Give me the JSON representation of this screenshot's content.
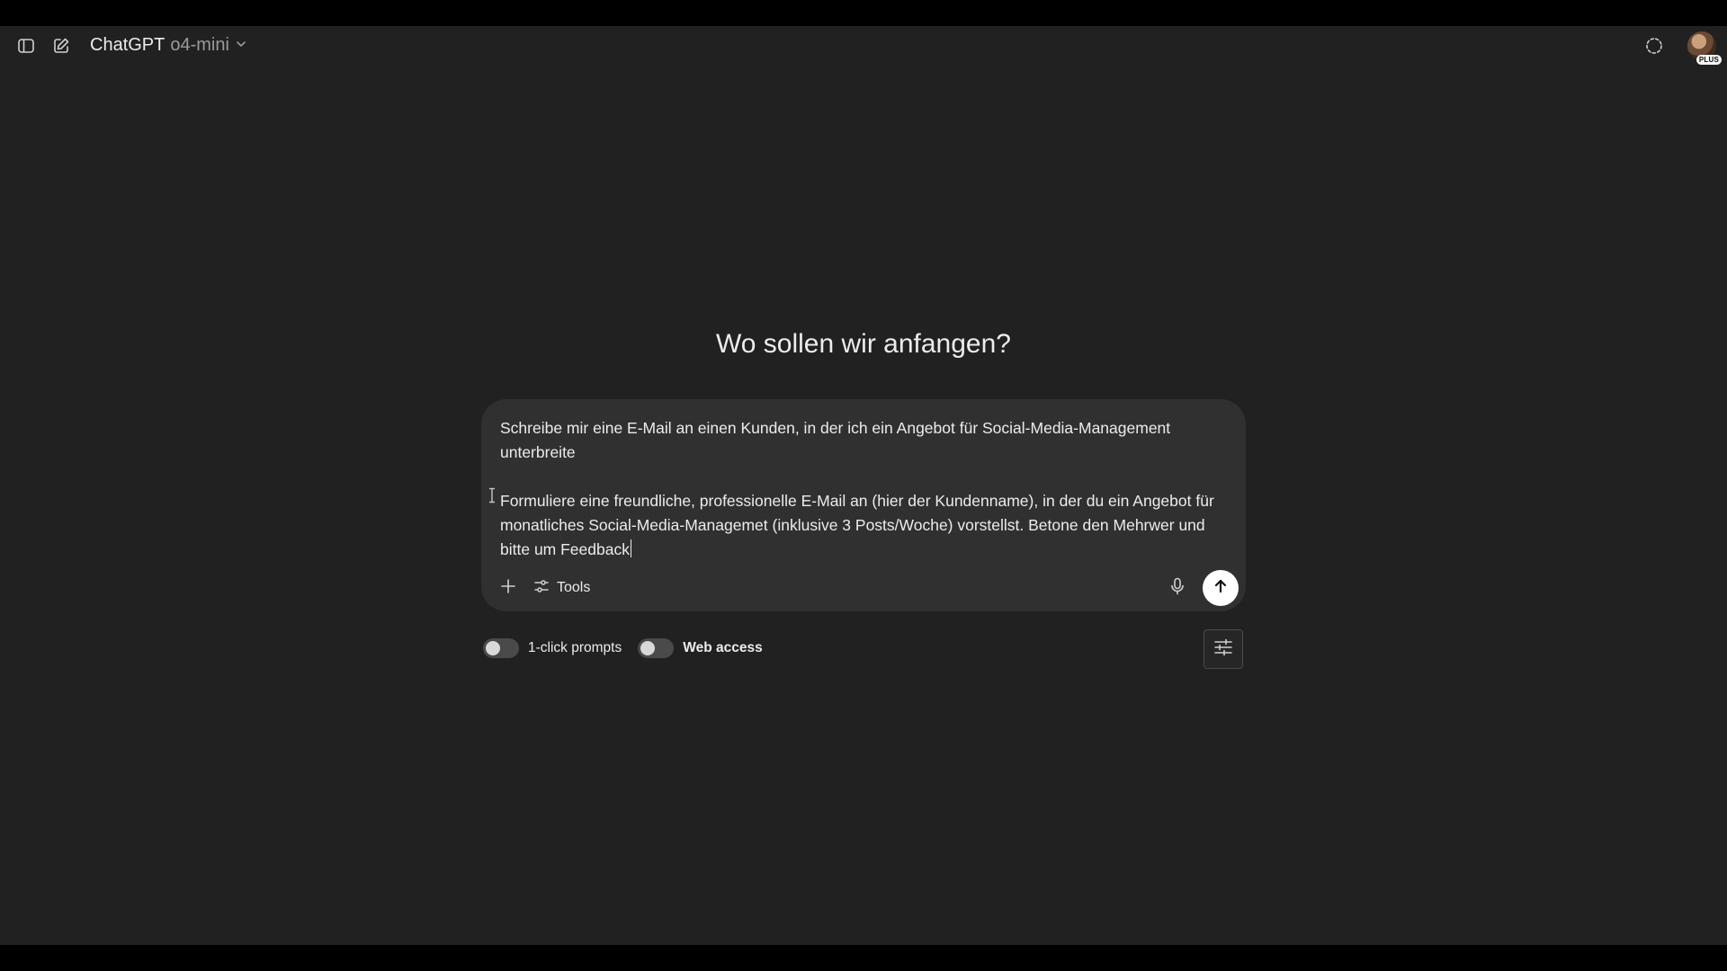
{
  "header": {
    "model_name": "ChatGPT",
    "model_variant": "o4-mini",
    "badge": "PLUS",
    "icons": [
      "sidebar-toggle-icon",
      "new-chat-icon",
      "chevron-down-icon",
      "temporary-chat-icon"
    ]
  },
  "main": {
    "headline": "Wo sollen wir anfangen?"
  },
  "composer": {
    "text": "Schreibe mir eine E-Mail an einen Kunden, in der ich ein Angebot für Social-Media-Management unterbreite\n\nFormuliere eine freundliche, professionelle E-Mail an (hier der Kundenname), in der du ein Angebot für monatliches Social-Media-Managemet (inklusive 3 Posts/Woche) vorstellst. Betone den Mehrwer und bitte um Feedback",
    "tools_label": "Tools",
    "icons": [
      "plus-icon",
      "tools-icon",
      "microphone-icon",
      "arrow-up-icon"
    ]
  },
  "toggles": {
    "one_click_prompts": {
      "label": "1-click prompts",
      "on": false
    },
    "web_access": {
      "label": "Web access",
      "on": false
    }
  },
  "colors": {
    "background": "#212121",
    "composer": "#303030",
    "text": "#ececec",
    "muted": "#9b9b9b",
    "send_button": "#ffffff"
  }
}
